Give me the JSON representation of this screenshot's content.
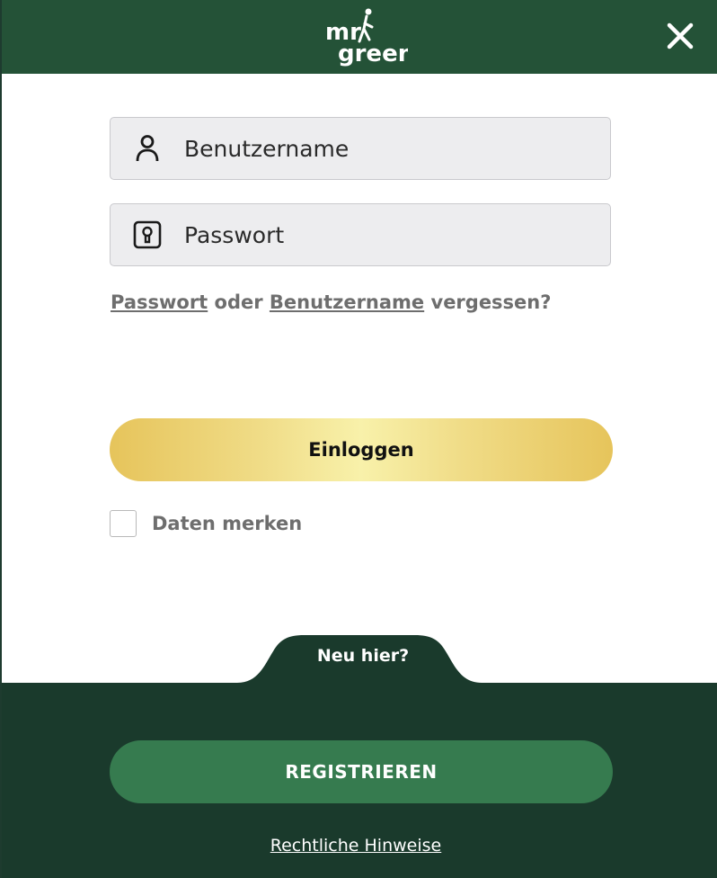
{
  "header": {
    "logo_line1": "mr",
    "logo_line2": "green",
    "close_icon": "close-icon",
    "background_color": "#245237"
  },
  "login_form": {
    "username_placeholder": "Benutzername",
    "username_icon": "user-icon",
    "password_placeholder": "Passwort",
    "password_icon": "keyhole-lock-icon",
    "forgot": {
      "password_link": "Passwort",
      "connector": " oder ",
      "username_link": "Benutzername",
      "suffix": " vergessen?"
    },
    "login_button": "Einloggen",
    "remember_label": "Daten merken",
    "remember_checked": false
  },
  "footer": {
    "tab_label": "Neu hier?",
    "register_button": "REGISTRIEREN",
    "legal_link": "Rechtliche Hinweise",
    "background_color": "#1a3a2c",
    "register_color": "#367b4f"
  }
}
